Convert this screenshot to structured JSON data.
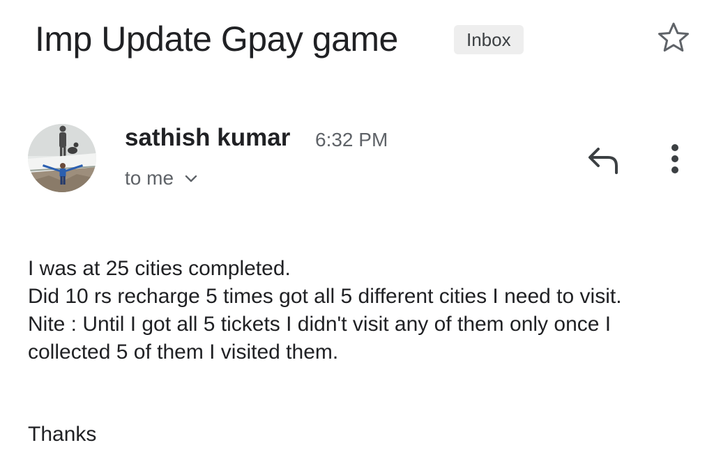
{
  "email": {
    "subject": "Imp Update Gpay game",
    "label": "Inbox",
    "sender": {
      "name": "sathish kumar",
      "time": "6:32 PM",
      "recipient": "to me"
    },
    "body_lines": [
      "I was at 25 cities completed.",
      "Did 10 rs recharge 5 times got all 5 different cities I need to visit.",
      "Nite : Until I got all 5 tickets I didn't visit any of them only once I collected 5 of them I visited them."
    ],
    "signoff": "Thanks"
  },
  "icons": {
    "star": "star-outline-icon",
    "reply": "reply-icon",
    "more": "more-vert-icon",
    "expand": "chevron-down-icon"
  },
  "colors": {
    "text": "#202124",
    "secondary_text": "#5f6368",
    "chip_bg": "#eeeeee"
  }
}
